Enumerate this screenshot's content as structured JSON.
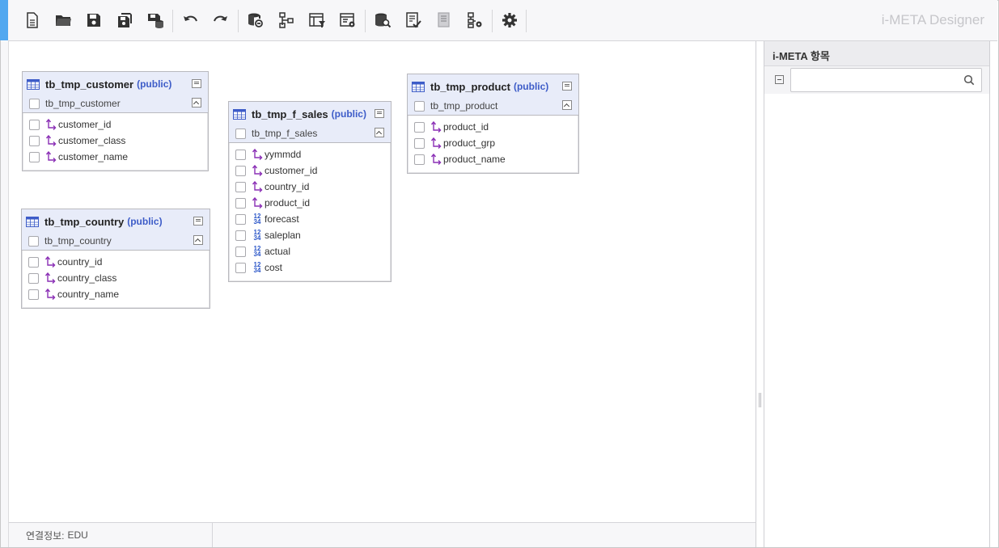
{
  "app": {
    "title": "i-META Designer"
  },
  "toolbar": {
    "buttons": [
      {
        "icon": "new-document-icon"
      },
      {
        "icon": "open-folder-icon"
      },
      {
        "icon": "save-icon"
      },
      {
        "icon": "save-all-icon"
      },
      {
        "icon": "save-to-database-icon"
      },
      {
        "icon": "undo-icon"
      },
      {
        "icon": "redo-icon"
      },
      {
        "icon": "database-link-icon"
      },
      {
        "icon": "hierarchy-icon"
      },
      {
        "icon": "table-filter-icon"
      },
      {
        "icon": "table-settings-icon"
      },
      {
        "icon": "database-search-icon"
      },
      {
        "icon": "checklist-icon"
      },
      {
        "icon": "report-icon"
      },
      {
        "icon": "hierarchy-settings-icon"
      },
      {
        "icon": "gear-icon"
      }
    ]
  },
  "tables": [
    {
      "name": "tb_tmp_customer",
      "schema": "(public)",
      "alias": "tb_tmp_customer",
      "columns": [
        {
          "name": "customer_id",
          "type": "key"
        },
        {
          "name": "customer_class",
          "type": "key"
        },
        {
          "name": "customer_name",
          "type": "key"
        }
      ]
    },
    {
      "name": "tb_tmp_country",
      "schema": "(public)",
      "alias": "tb_tmp_country",
      "columns": [
        {
          "name": "country_id",
          "type": "key"
        },
        {
          "name": "country_class",
          "type": "key"
        },
        {
          "name": "country_name",
          "type": "key"
        }
      ]
    },
    {
      "name": "tb_tmp_f_sales",
      "schema": "(public)",
      "alias": "tb_tmp_f_sales",
      "columns": [
        {
          "name": "yymmdd",
          "type": "key"
        },
        {
          "name": "customer_id",
          "type": "key"
        },
        {
          "name": "country_id",
          "type": "key"
        },
        {
          "name": "product_id",
          "type": "key"
        },
        {
          "name": "forecast",
          "type": "numeric"
        },
        {
          "name": "saleplan",
          "type": "numeric"
        },
        {
          "name": "actual",
          "type": "numeric"
        },
        {
          "name": "cost",
          "type": "numeric"
        }
      ]
    },
    {
      "name": "tb_tmp_product",
      "schema": "(public)",
      "alias": "tb_tmp_product",
      "columns": [
        {
          "name": "product_id",
          "type": "key"
        },
        {
          "name": "product_grp",
          "type": "key"
        },
        {
          "name": "product_name",
          "type": "key"
        }
      ]
    }
  ],
  "status": {
    "label": "연결정보:",
    "value": "EDU"
  },
  "right_panel": {
    "title": "i-META 항목",
    "search_value": "",
    "search_placeholder": ""
  },
  "colors": {
    "accent": "#52a8f0",
    "schema": "#3d5cc8",
    "key_icon": "#8a2fb5",
    "numeric_icon": "#2b56c8",
    "table_header": "#e8ecf9"
  }
}
